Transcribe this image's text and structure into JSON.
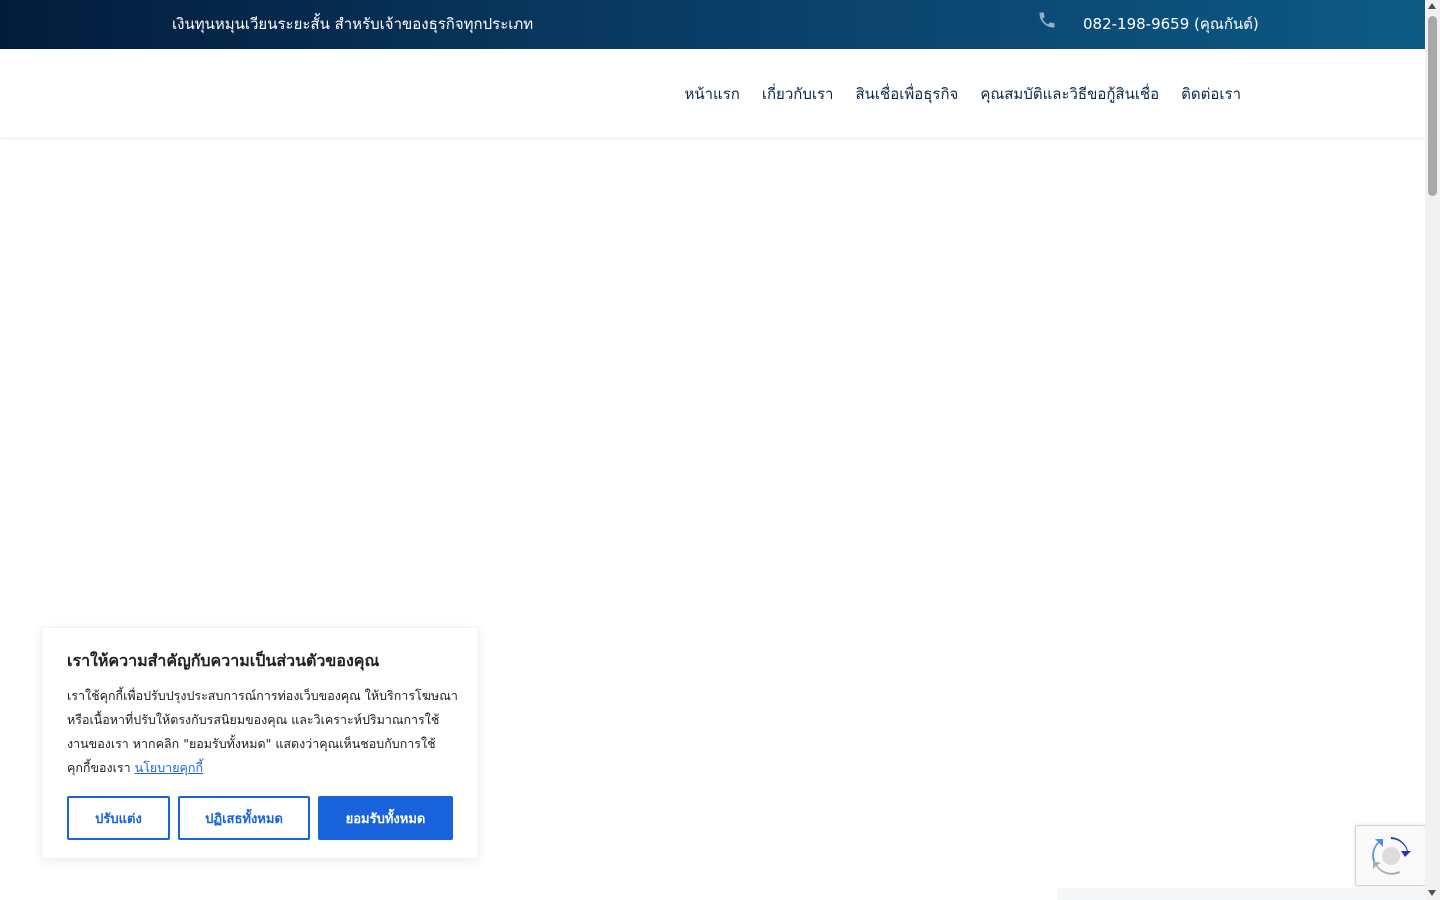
{
  "topbar": {
    "tagline": "เงินทุนหมุนเวียนระยะสั้น สำหรับเจ้าของธุรกิจทุกประเภท",
    "phone": "082-198-9659 (คุณกันต์)",
    "phone_icon": "phone-icon"
  },
  "nav": {
    "items": [
      {
        "label": "หน้าแรก"
      },
      {
        "label": "เกี่ยวกับเรา"
      },
      {
        "label": "สินเชื่อเพื่อธุรกิจ"
      },
      {
        "label": "คุณสมบัติและวิธีขอกู้สินเชื่อ"
      },
      {
        "label": "ติดต่อเรา"
      }
    ]
  },
  "cookie": {
    "title": "เราให้ความสำคัญกับความเป็นส่วนตัวของคุณ",
    "body": "เราใช้คุกกี้เพื่อปรับปรุงประสบการณ์การท่องเว็บของคุณ ให้บริการโฆษณาหรือเนื้อหาที่ปรับให้ตรงกับรสนิยมของคุณ และวิเคราะห์ปริมาณการใช้งานของเรา หากคลิก \"ยอมรับทั้งหมด\" แสดงว่าคุณเห็นชอบกับการใช้คุกกี้ของเรา",
    "policy_link": "นโยบายคุกกี้",
    "customize_label": "ปรับแต่ง",
    "reject_label": "ปฏิเสธทั้งหมด",
    "accept_label": "ยอมรับทั้งหมด"
  },
  "colors": {
    "topbar_start": "#031b3a",
    "topbar_end": "#0d5a86",
    "nav_text": "#0b2a4a",
    "cookie_accent": "#1863dc"
  },
  "recaptcha": {
    "icon": "recaptcha-icon"
  }
}
